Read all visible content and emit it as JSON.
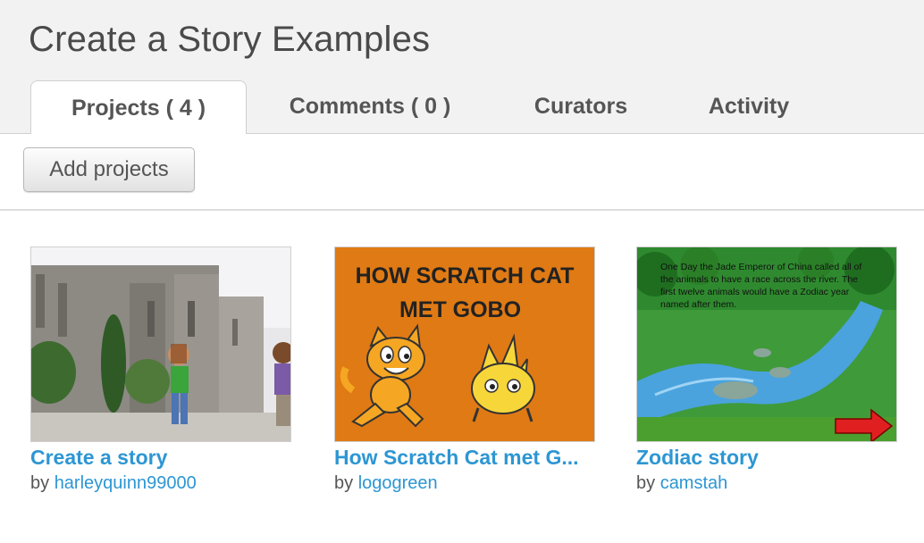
{
  "page": {
    "title": "Create a Story Examples"
  },
  "tabs": [
    {
      "label": "Projects ( 4 )",
      "active": true
    },
    {
      "label": "Comments ( 0 )",
      "active": false
    },
    {
      "label": "Curators",
      "active": false
    },
    {
      "label": "Activity",
      "active": false
    }
  ],
  "toolbar": {
    "add_projects_label": "Add projects"
  },
  "projects": [
    {
      "title": "Create a story",
      "by": "by",
      "author": "harleyquinn99000"
    },
    {
      "title": "How Scratch Cat met G...",
      "by": "by",
      "author": "logogreen",
      "thumb_text": [
        "HOW SCRATCH CAT",
        "MET GOBO"
      ]
    },
    {
      "title": "Zodiac story",
      "by": "by",
      "author": "camstah",
      "thumb_text": [
        "One Day the Jade Emperor of China called all of",
        "the animals to have a race across the river.  The",
        "first twelve animals would have a Zodiac year",
        "named after them."
      ]
    }
  ],
  "colors": {
    "link": "#2d96d3",
    "header_bg": "#f2f2f2",
    "text": "#555555"
  }
}
